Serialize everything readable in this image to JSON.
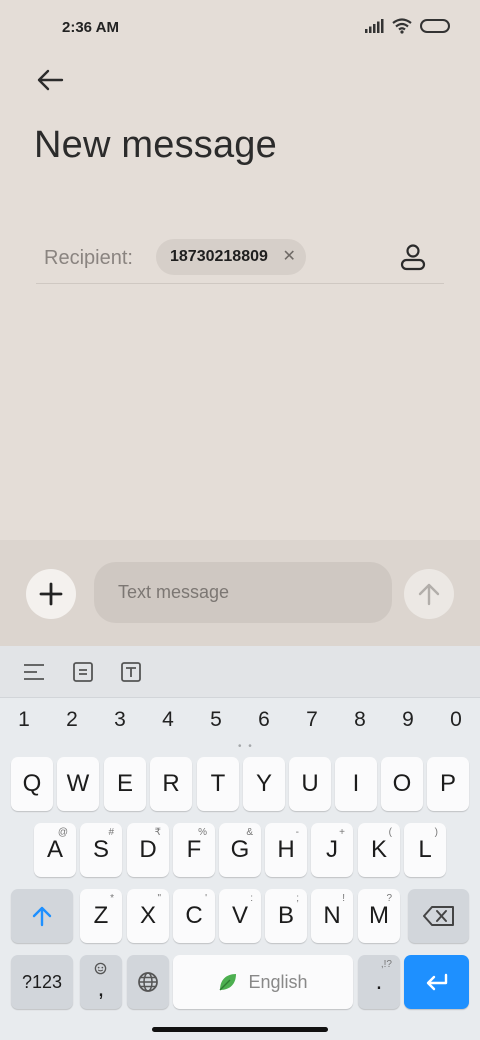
{
  "status": {
    "time": "2:36 AM"
  },
  "header": {
    "title": "New message"
  },
  "recipient": {
    "label": "Recipient:",
    "chip": "18730218809"
  },
  "compose": {
    "placeholder": "Text message"
  },
  "keyboard": {
    "numbers": [
      "1",
      "2",
      "3",
      "4",
      "5",
      "6",
      "7",
      "8",
      "9",
      "0"
    ],
    "row1": [
      "Q",
      "W",
      "E",
      "R",
      "T",
      "Y",
      "U",
      "I",
      "O",
      "P"
    ],
    "row2": [
      {
        "k": "A",
        "s": "@"
      },
      {
        "k": "S",
        "s": "#"
      },
      {
        "k": "D",
        "s": "₹"
      },
      {
        "k": "F",
        "s": "%"
      },
      {
        "k": "G",
        "s": "&"
      },
      {
        "k": "H",
        "s": "-"
      },
      {
        "k": "J",
        "s": "+"
      },
      {
        "k": "K",
        "s": "("
      },
      {
        "k": "L",
        "s": ")"
      }
    ],
    "row3": [
      {
        "k": "Z",
        "s": "*"
      },
      {
        "k": "X",
        "s": "\""
      },
      {
        "k": "C",
        "s": "'"
      },
      {
        "k": "V",
        "s": ":"
      },
      {
        "k": "B",
        "s": ";"
      },
      {
        "k": "N",
        "s": "!"
      },
      {
        "k": "M",
        "s": "?"
      }
    ],
    "symbols_label": "?123",
    "comma_label": ",",
    "space_label": "English",
    "period_label": ".",
    "period_sub": ",!?"
  },
  "colors": {
    "accent": "#1e90ff",
    "background": "#e4ddd7"
  }
}
